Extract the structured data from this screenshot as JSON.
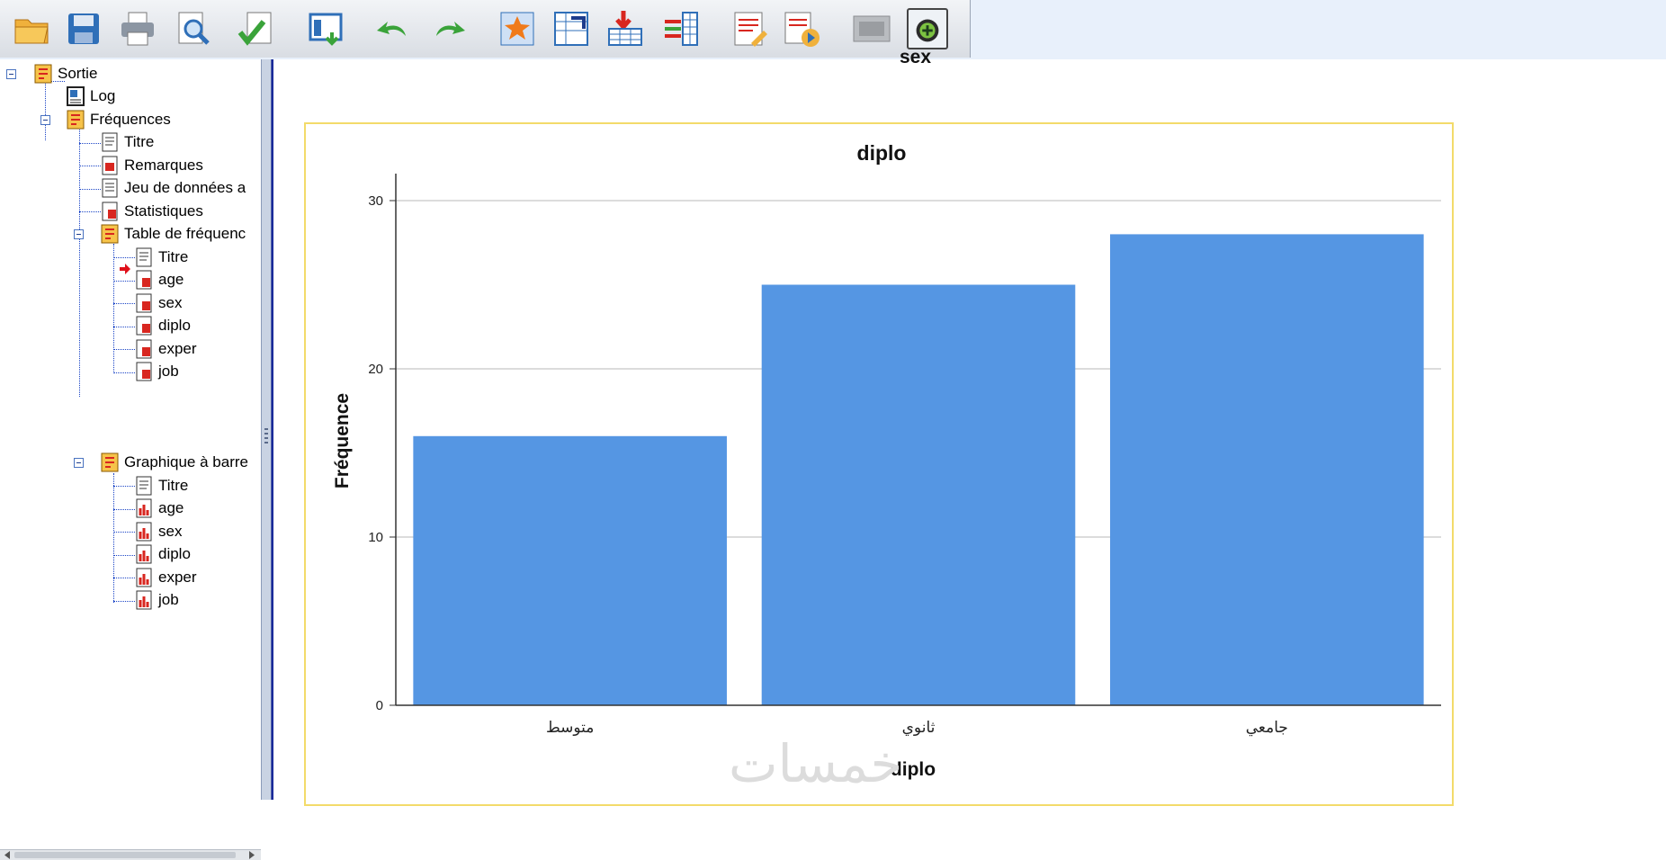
{
  "toolbar": {
    "buttons": [
      {
        "name": "open-icon"
      },
      {
        "name": "save-icon"
      },
      {
        "name": "print-icon"
      },
      {
        "name": "print-preview-icon"
      },
      {
        "name": "export-icon"
      },
      {
        "name": "recall-dialog-icon"
      },
      {
        "name": "undo-icon"
      },
      {
        "name": "redo-icon"
      },
      {
        "name": "goto-case-icon"
      },
      {
        "name": "goto-variable-icon"
      },
      {
        "name": "insert-cases-icon"
      },
      {
        "name": "variables-icon"
      },
      {
        "name": "designate-window-icon"
      },
      {
        "name": "run-script-icon"
      },
      {
        "name": "disabled-pane-icon"
      },
      {
        "name": "add-item-icon"
      }
    ]
  },
  "tree": {
    "root": "Sortie",
    "log": "Log",
    "frequencies": "Fréquences",
    "freq_children": [
      "Titre",
      "Remarques",
      "Jeu de données a",
      "Statistiques"
    ],
    "table": "Table de fréquenc",
    "table_children": [
      "Titre",
      "age",
      "sex",
      "diplo",
      "exper",
      "job"
    ],
    "bar_chart": "Graphique à barre",
    "bar_children": [
      "Titre",
      "age",
      "sex",
      "diplo",
      "exper",
      "job"
    ]
  },
  "viewer": {
    "previous_title": "sex",
    "watermark": "خمسات"
  },
  "colors": {
    "bar": "#5596e3",
    "frame": "#f3db6a",
    "grid": "#d0d0d0"
  },
  "chart_data": {
    "type": "bar",
    "title": "diplo",
    "xlabel": "diplo",
    "ylabel": "Fréquence",
    "categories": [
      "متوسط",
      "ثانوي",
      "جامعي"
    ],
    "values": [
      16,
      25,
      28
    ],
    "ylim": [
      0,
      30
    ],
    "yticks": [
      0,
      10,
      20,
      30
    ],
    "grid": true
  }
}
